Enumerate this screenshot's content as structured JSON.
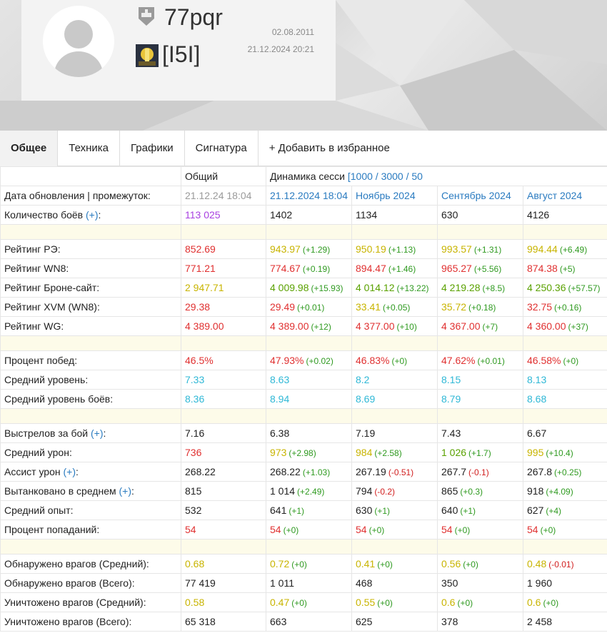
{
  "profile": {
    "nickname": "77pqr",
    "clan_tag": "[I5I]",
    "registered_date": "02.08.2011",
    "last_update": "21.12.2024 20:21"
  },
  "tabs": [
    {
      "label": "Общее",
      "active": true
    },
    {
      "label": "Техника"
    },
    {
      "label": "Графики"
    },
    {
      "label": "Сигнатура"
    },
    {
      "label": "+ Добавить в избранное"
    }
  ],
  "table": {
    "head": {
      "overall": "Общий",
      "dynamics": "Динамика сесси",
      "dynamics_links": "[1000 / 3000 / 50"
    },
    "update_row": {
      "label": "Дата обновления | промежуток:",
      "overall": "21.12.24 18:04",
      "periods": [
        "21.12.2024 18:04",
        "Ноябрь 2024",
        "Сентябрь 2024",
        "Август 2024"
      ]
    },
    "battles_row": {
      "label": "Количество боёв",
      "link": "(+)",
      "overall": "113 025",
      "periods": [
        "1402",
        "1134",
        "630",
        "4126"
      ]
    },
    "ratings": [
      {
        "label": "Рейтинг РЭ:",
        "overall": {
          "v": "852.69",
          "c": "red"
        },
        "periods": [
          {
            "v": "943.97",
            "c": "yellow",
            "d": "(+1.29)",
            "s": "pos"
          },
          {
            "v": "950.19",
            "c": "yellow",
            "d": "(+1.13)",
            "s": "pos"
          },
          {
            "v": "993.57",
            "c": "yellow",
            "d": "(+1.31)",
            "s": "pos"
          },
          {
            "v": "994.44",
            "c": "yellow",
            "d": "(+6.49)",
            "s": "pos"
          }
        ]
      },
      {
        "label": "Рейтинг WN8:",
        "overall": {
          "v": "771.21",
          "c": "red"
        },
        "periods": [
          {
            "v": "774.67",
            "c": "red",
            "d": "(+0.19)",
            "s": "pos"
          },
          {
            "v": "894.47",
            "c": "red",
            "d": "(+1.46)",
            "s": "pos"
          },
          {
            "v": "965.27",
            "c": "red",
            "d": "(+5.56)",
            "s": "pos"
          },
          {
            "v": "874.38",
            "c": "red",
            "d": "(+5)",
            "s": "pos"
          }
        ]
      },
      {
        "label": "Рейтинг Броне-сайт:",
        "overall": {
          "v": "2 947.71",
          "c": "yellow"
        },
        "periods": [
          {
            "v": "4 009.98",
            "c": "green",
            "d": "(+15.93)",
            "s": "pos"
          },
          {
            "v": "4 014.12",
            "c": "green",
            "d": "(+13.22)",
            "s": "pos"
          },
          {
            "v": "4 219.28",
            "c": "green",
            "d": "(+8.5)",
            "s": "pos"
          },
          {
            "v": "4 250.36",
            "c": "green",
            "d": "(+57.57)",
            "s": "pos"
          }
        ]
      },
      {
        "label": "Рейтинг XVM (WN8):",
        "overall": {
          "v": "29.38",
          "c": "red"
        },
        "periods": [
          {
            "v": "29.49",
            "c": "red",
            "d": "(+0.01)",
            "s": "pos"
          },
          {
            "v": "33.41",
            "c": "yellow",
            "d": "(+0.05)",
            "s": "pos"
          },
          {
            "v": "35.72",
            "c": "yellow",
            "d": "(+0.18)",
            "s": "pos"
          },
          {
            "v": "32.75",
            "c": "red",
            "d": "(+0.16)",
            "s": "pos"
          }
        ]
      },
      {
        "label": "Рейтинг WG:",
        "overall": {
          "v": "4 389.00",
          "c": "red"
        },
        "periods": [
          {
            "v": "4 389.00",
            "c": "red",
            "d": "(+12)",
            "s": "pos"
          },
          {
            "v": "4 377.00",
            "c": "red",
            "d": "(+10)",
            "s": "pos"
          },
          {
            "v": "4 367.00",
            "c": "red",
            "d": "(+7)",
            "s": "pos"
          },
          {
            "v": "4 360.00",
            "c": "red",
            "d": "(+37)",
            "s": "pos"
          }
        ]
      }
    ],
    "general": [
      {
        "label": "Процент побед:",
        "overall": {
          "v": "46.5%",
          "c": "red"
        },
        "periods": [
          {
            "v": "47.93%",
            "c": "red",
            "d": "(+0.02)",
            "s": "pos"
          },
          {
            "v": "46.83%",
            "c": "red",
            "d": "(+0)",
            "s": "pos"
          },
          {
            "v": "47.62%",
            "c": "red",
            "d": "(+0.01)",
            "s": "pos"
          },
          {
            "v": "46.58%",
            "c": "red",
            "d": "(+0)",
            "s": "pos"
          }
        ]
      },
      {
        "label": "Средний уровень:",
        "overall": {
          "v": "7.33",
          "c": "cyan"
        },
        "periods": [
          {
            "v": "8.63",
            "c": "cyan"
          },
          {
            "v": "8.2",
            "c": "cyan"
          },
          {
            "v": "8.15",
            "c": "cyan"
          },
          {
            "v": "8.13",
            "c": "cyan"
          }
        ]
      },
      {
        "label": "Средний уровень боёв:",
        "overall": {
          "v": "8.36",
          "c": "cyan"
        },
        "periods": [
          {
            "v": "8.94",
            "c": "cyan"
          },
          {
            "v": "8.69",
            "c": "cyan"
          },
          {
            "v": "8.79",
            "c": "cyan"
          },
          {
            "v": "8.68",
            "c": "cyan"
          }
        ]
      }
    ],
    "combat": [
      {
        "label": "Выстрелов за бой",
        "link": "(+)",
        "overall": {
          "v": "7.16",
          "c": "black"
        },
        "periods": [
          {
            "v": "6.38",
            "c": "black"
          },
          {
            "v": "7.19",
            "c": "black"
          },
          {
            "v": "7.43",
            "c": "black"
          },
          {
            "v": "6.67",
            "c": "black"
          }
        ]
      },
      {
        "label": "Средний урон:",
        "overall": {
          "v": "736",
          "c": "red"
        },
        "periods": [
          {
            "v": "973",
            "c": "yellow",
            "d": "(+2.98)",
            "s": "pos"
          },
          {
            "v": "984",
            "c": "yellow",
            "d": "(+2.58)",
            "s": "pos"
          },
          {
            "v": "1 026",
            "c": "green",
            "d": "(+1.7)",
            "s": "pos"
          },
          {
            "v": "995",
            "c": "yellow",
            "d": "(+10.4)",
            "s": "pos"
          }
        ]
      },
      {
        "label": "Ассист урон",
        "link": "(+)",
        "overall": {
          "v": "268.22",
          "c": "black"
        },
        "periods": [
          {
            "v": "268.22",
            "c": "black",
            "d": "(+1.03)",
            "s": "pos"
          },
          {
            "v": "267.19",
            "c": "black",
            "d": "(-0.51)",
            "s": "neg"
          },
          {
            "v": "267.7",
            "c": "black",
            "d": "(-0.1)",
            "s": "neg"
          },
          {
            "v": "267.8",
            "c": "black",
            "d": "(+0.25)",
            "s": "pos"
          }
        ]
      },
      {
        "label": "Вытанковано в среднем",
        "link": "(+)",
        "overall": {
          "v": "815",
          "c": "black"
        },
        "periods": [
          {
            "v": "1 014",
            "c": "black",
            "d": "(+2.49)",
            "s": "pos"
          },
          {
            "v": "794",
            "c": "black",
            "d": "(-0.2)",
            "s": "neg"
          },
          {
            "v": "865",
            "c": "black",
            "d": "(+0.3)",
            "s": "pos"
          },
          {
            "v": "918",
            "c": "black",
            "d": "(+4.09)",
            "s": "pos"
          }
        ]
      },
      {
        "label": "Средний опыт:",
        "overall": {
          "v": "532",
          "c": "black"
        },
        "periods": [
          {
            "v": "641",
            "c": "black",
            "d": "(+1)",
            "s": "pos"
          },
          {
            "v": "630",
            "c": "black",
            "d": "(+1)",
            "s": "pos"
          },
          {
            "v": "640",
            "c": "black",
            "d": "(+1)",
            "s": "pos"
          },
          {
            "v": "627",
            "c": "black",
            "d": "(+4)",
            "s": "pos"
          }
        ]
      },
      {
        "label": "Процент попаданий:",
        "overall": {
          "v": "54",
          "c": "red"
        },
        "periods": [
          {
            "v": "54",
            "c": "red",
            "d": "(+0)",
            "s": "pos"
          },
          {
            "v": "54",
            "c": "red",
            "d": "(+0)",
            "s": "pos"
          },
          {
            "v": "54",
            "c": "red",
            "d": "(+0)",
            "s": "pos"
          },
          {
            "v": "54",
            "c": "red",
            "d": "(+0)",
            "s": "pos"
          }
        ]
      }
    ],
    "spotting": [
      {
        "label": "Обнаружено врагов (Средний):",
        "overall": {
          "v": "0.68",
          "c": "yellow"
        },
        "periods": [
          {
            "v": "0.72",
            "c": "yellow",
            "d": "(+0)",
            "s": "pos"
          },
          {
            "v": "0.41",
            "c": "yellow",
            "d": "(+0)",
            "s": "pos"
          },
          {
            "v": "0.56",
            "c": "yellow",
            "d": "(+0)",
            "s": "pos"
          },
          {
            "v": "0.48",
            "c": "yellow",
            "d": "(-0.01)",
            "s": "neg"
          }
        ]
      },
      {
        "label": "Обнаружено врагов (Всего):",
        "overall": {
          "v": "77 419",
          "c": "black"
        },
        "periods": [
          {
            "v": "1 011",
            "c": "black"
          },
          {
            "v": "468",
            "c": "black"
          },
          {
            "v": "350",
            "c": "black"
          },
          {
            "v": "1 960",
            "c": "black"
          }
        ]
      },
      {
        "label": "Уничтожено врагов (Средний):",
        "overall": {
          "v": "0.58",
          "c": "yellow"
        },
        "periods": [
          {
            "v": "0.47",
            "c": "yellow",
            "d": "(+0)",
            "s": "pos"
          },
          {
            "v": "0.55",
            "c": "yellow",
            "d": "(+0)",
            "s": "pos"
          },
          {
            "v": "0.6",
            "c": "yellow",
            "d": "(+0)",
            "s": "pos"
          },
          {
            "v": "0.6",
            "c": "yellow",
            "d": "(+0)",
            "s": "pos"
          }
        ]
      },
      {
        "label": "Уничтожено врагов (Всего):",
        "overall": {
          "v": "65 318",
          "c": "black"
        },
        "periods": [
          {
            "v": "663",
            "c": "black"
          },
          {
            "v": "625",
            "c": "black"
          },
          {
            "v": "378",
            "c": "black"
          },
          {
            "v": "2 458",
            "c": "black"
          }
        ]
      }
    ]
  }
}
